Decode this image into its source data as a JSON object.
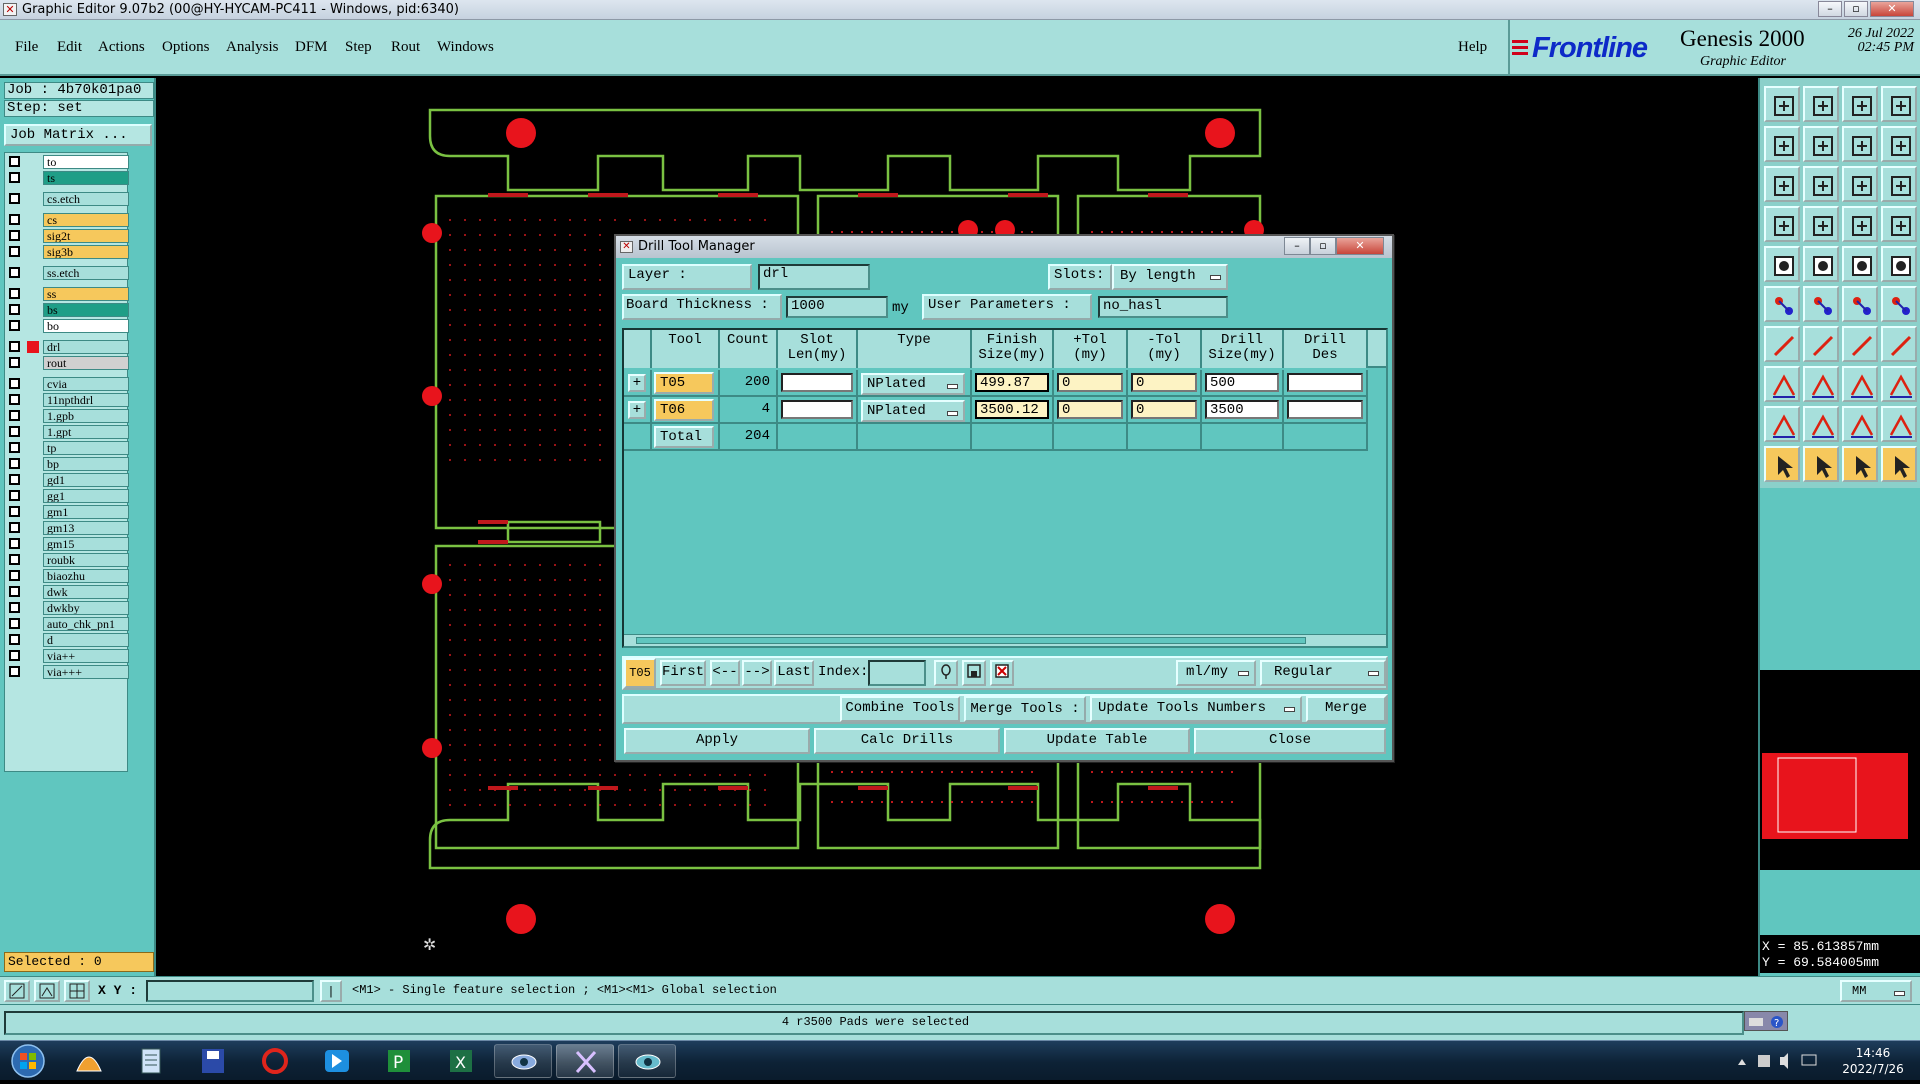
{
  "window": {
    "title": "Graphic Editor 9.07b2 (00@HY-HYCAM-PC411 - Windows, pid:6340)"
  },
  "menu": {
    "items": [
      "File",
      "Edit",
      "Actions",
      "Options",
      "Analysis",
      "DFM",
      "Step",
      "Rout",
      "Windows"
    ],
    "help": "Help"
  },
  "brand": {
    "logo": "Frontline",
    "product": "Genesis 2000",
    "subtitle": "Graphic Editor",
    "date": "26 Jul 2022",
    "time": "02:45 PM"
  },
  "job": {
    "job_label": "Job  : 4b70k01pa0",
    "step_label": "Step: set",
    "job_matrix_button": "Job Matrix ..."
  },
  "layers": [
    {
      "name": "to",
      "color": "#ffffff"
    },
    {
      "name": "ts",
      "color": "#1f9e87"
    },
    {
      "name": "cs.etch",
      "color": "#a7dfdb"
    },
    {
      "name": "cs",
      "color": "#f6c85c"
    },
    {
      "name": "sig2t",
      "color": "#f6c85c"
    },
    {
      "name": "sig3b",
      "color": "#f6c85c"
    },
    {
      "name": "ss.etch",
      "color": "#a7dfdb"
    },
    {
      "name": "ss",
      "color": "#f6c85c"
    },
    {
      "name": "bs",
      "color": "#1f9e87"
    },
    {
      "name": "bo",
      "color": "#ffffff"
    },
    {
      "name": "drl",
      "color": "#a7dfdb"
    },
    {
      "name": "rout",
      "color": "#d0d0d0"
    },
    {
      "name": "cvia",
      "color": "#a7dfdb"
    },
    {
      "name": "11npthdrl",
      "color": "#a7dfdb"
    },
    {
      "name": "1.gpb",
      "color": "#a7dfdb"
    },
    {
      "name": "1.gpt",
      "color": "#a7dfdb"
    },
    {
      "name": "tp",
      "color": "#a7dfdb"
    },
    {
      "name": "bp",
      "color": "#a7dfdb"
    },
    {
      "name": "gd1",
      "color": "#a7dfdb"
    },
    {
      "name": "gg1",
      "color": "#a7dfdb"
    },
    {
      "name": "gm1",
      "color": "#a7dfdb"
    },
    {
      "name": "gm13",
      "color": "#a7dfdb"
    },
    {
      "name": "gm15",
      "color": "#a7dfdb"
    },
    {
      "name": "roubk",
      "color": "#a7dfdb"
    },
    {
      "name": "biaozhu",
      "color": "#a7dfdb"
    },
    {
      "name": "dwk",
      "color": "#a7dfdb"
    },
    {
      "name": "dwkby",
      "color": "#a7dfdb"
    },
    {
      "name": "auto_chk_pn1",
      "color": "#a7dfdb"
    },
    {
      "name": "d",
      "color": "#a7dfdb"
    },
    {
      "name": "via++",
      "color": "#a7dfdb"
    },
    {
      "name": "via+++",
      "color": "#a7dfdb"
    }
  ],
  "selected": "Selected : 0",
  "dialog": {
    "title": "Drill Tool Manager",
    "layer_label": "Layer          :",
    "layer_value": "drl",
    "slots_label": "Slots:",
    "slots_value": "By length",
    "thickness_label": "Board Thickness :",
    "thickness_value": "1000",
    "thickness_unit": "my",
    "user_params_label": "User Parameters :",
    "user_params_value": "no_hasl",
    "columns": [
      {
        "l1": "Tool",
        "l2": ""
      },
      {
        "l1": "Count",
        "l2": ""
      },
      {
        "l1": "Slot",
        "l2": "Len(my)"
      },
      {
        "l1": "Type",
        "l2": ""
      },
      {
        "l1": "Finish",
        "l2": "Size(my)"
      },
      {
        "l1": "+Tol",
        "l2": "(my)"
      },
      {
        "l1": "-Tol",
        "l2": "(my)"
      },
      {
        "l1": "Drill",
        "l2": "Size(my)"
      },
      {
        "l1": "Drill",
        "l2": "Des"
      }
    ],
    "rows": [
      {
        "tool": "T05",
        "count": "200",
        "slot": "",
        "type": "NPlated",
        "finish": "499.87",
        "ptol": "0",
        "mtol": "0",
        "drill": "500",
        "des": ""
      },
      {
        "tool": "T06",
        "count": "4",
        "slot": "",
        "type": "NPlated",
        "finish": "3500.12",
        "ptol": "0",
        "mtol": "0",
        "drill": "3500",
        "des": ""
      }
    ],
    "total_label": "Total",
    "total_count": "204",
    "current_tool": "T05",
    "nav": {
      "first": "First",
      "prev": "<--",
      "next": "-->",
      "last": "Last",
      "index_label": "Index:",
      "index_value": "",
      "units": "ml/my",
      "mode": "Regular"
    },
    "actions": {
      "combine": "Combine Tools",
      "merge_tools": "Merge Tools :",
      "update_numbers": "Update Tools Numbers",
      "merge": "Merge"
    },
    "buttons": {
      "apply": "Apply",
      "calc": "Calc Drills",
      "update": "Update Table",
      "close": "Close"
    }
  },
  "coords": {
    "x": "X = 85.613857mm",
    "y": "Y = 69.584005mm"
  },
  "bottombar": {
    "xy_label": "X Y :",
    "xy_value": "",
    "hint": "<M1> - Single feature selection ; <M1><M1> Global selection",
    "units": "MM"
  },
  "status": {
    "message": "4 r3500 Pads were selected"
  },
  "taskbar": {
    "time": "14:46",
    "date": "2022/7/26"
  }
}
